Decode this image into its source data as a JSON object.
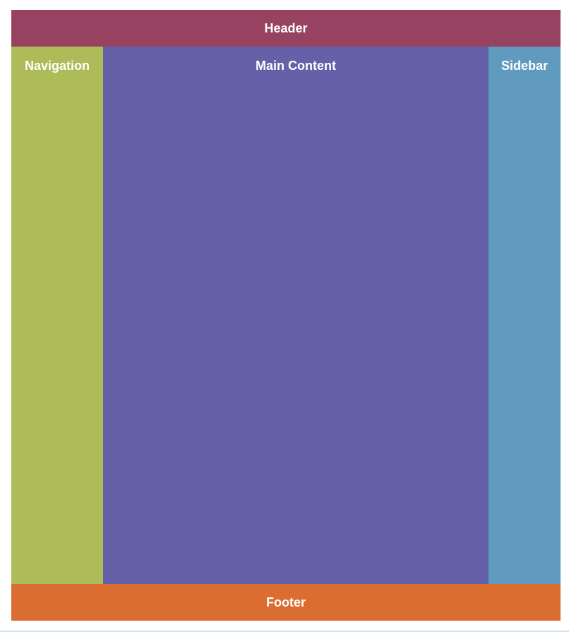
{
  "regions": {
    "header": "Header",
    "navigation": "Navigation",
    "main_content": "Main Content",
    "sidebar": "Sidebar",
    "footer": "Footer"
  },
  "colors": {
    "header": "#974260",
    "navigation": "#adbb58",
    "main_content": "#6461a9",
    "sidebar": "#619abf",
    "footer": "#db6d30",
    "text": "#ffffff"
  }
}
